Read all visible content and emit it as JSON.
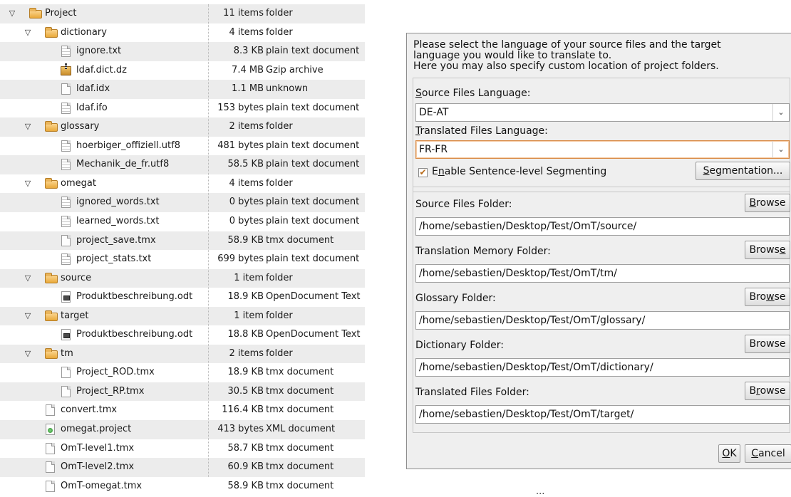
{
  "tree": {
    "rows": [
      {
        "name": "Project",
        "size": "11 items",
        "type": "folder",
        "kind": "folder",
        "depth": 0,
        "expander": true
      },
      {
        "name": "dictionary",
        "size": "4 items",
        "type": "folder",
        "kind": "folder",
        "depth": 1,
        "expander": true
      },
      {
        "name": "ignore.txt",
        "size": "8.3 KB",
        "type": "plain text document",
        "kind": "text",
        "depth": 2
      },
      {
        "name": "ldaf.dict.dz",
        "size": "7.4 MB",
        "type": "Gzip archive",
        "kind": "archive",
        "depth": 2
      },
      {
        "name": "ldaf.idx",
        "size": "1.1 MB",
        "type": "unknown",
        "kind": "file",
        "depth": 2
      },
      {
        "name": "ldaf.ifo",
        "size": "153 bytes",
        "type": "plain text document",
        "kind": "text",
        "depth": 2
      },
      {
        "name": "glossary",
        "size": "2 items",
        "type": "folder",
        "kind": "folder",
        "depth": 1,
        "expander": true
      },
      {
        "name": "hoerbiger_offiziell.utf8",
        "size": "481 bytes",
        "type": "plain text document",
        "kind": "text",
        "depth": 2
      },
      {
        "name": "Mechanik_de_fr.utf8",
        "size": "58.5 KB",
        "type": "plain text document",
        "kind": "text",
        "depth": 2
      },
      {
        "name": "omegat",
        "size": "4 items",
        "type": "folder",
        "kind": "folder",
        "depth": 1,
        "expander": true
      },
      {
        "name": "ignored_words.txt",
        "size": "0 bytes",
        "type": "plain text document",
        "kind": "text",
        "depth": 2
      },
      {
        "name": "learned_words.txt",
        "size": "0 bytes",
        "type": "plain text document",
        "kind": "text",
        "depth": 2
      },
      {
        "name": "project_save.tmx",
        "size": "58.9 KB",
        "type": "tmx document",
        "kind": "file",
        "depth": 2
      },
      {
        "name": "project_stats.txt",
        "size": "699 bytes",
        "type": "plain text document",
        "kind": "text",
        "depth": 2
      },
      {
        "name": "source",
        "size": "1 item",
        "type": "folder",
        "kind": "folder",
        "depth": 1,
        "expander": true
      },
      {
        "name": "Produktbeschreibung.odt",
        "size": "18.9 KB",
        "type": "OpenDocument Text",
        "kind": "odt",
        "depth": 2
      },
      {
        "name": "target",
        "size": "1 item",
        "type": "folder",
        "kind": "folder",
        "depth": 1,
        "expander": true
      },
      {
        "name": "Produktbeschreibung.odt",
        "size": "18.8 KB",
        "type": "OpenDocument Text",
        "kind": "odt",
        "depth": 2
      },
      {
        "name": "tm",
        "size": "2 items",
        "type": "folder",
        "kind": "folder",
        "depth": 1,
        "expander": true
      },
      {
        "name": "Project_ROD.tmx",
        "size": "18.9 KB",
        "type": "tmx document",
        "kind": "file",
        "depth": 2
      },
      {
        "name": "Project_RP.tmx",
        "size": "30.5 KB",
        "type": "tmx document",
        "kind": "file",
        "depth": 2
      },
      {
        "name": "convert.tmx",
        "size": "116.4 KB",
        "type": "tmx document",
        "kind": "file",
        "depth": 1
      },
      {
        "name": "omegat.project",
        "size": "413 bytes",
        "type": "XML document",
        "kind": "xml",
        "depth": 1
      },
      {
        "name": "OmT-level1.tmx",
        "size": "58.7 KB",
        "type": "tmx document",
        "kind": "file",
        "depth": 1
      },
      {
        "name": "OmT-level2.tmx",
        "size": "60.9 KB",
        "type": "tmx document",
        "kind": "file",
        "depth": 1
      },
      {
        "name": "OmT-omegat.tmx",
        "size": "58.9 KB",
        "type": "tmx document",
        "kind": "file",
        "depth": 1
      }
    ]
  },
  "dialog": {
    "intro": "Please select the language of your source files and the target\nlanguage you would like to translate to.\nHere you may also specify custom location of project folders.",
    "source_lang_label": {
      "pre": "",
      "key": "S",
      "post": "ource Files Language:"
    },
    "source_lang_value": "DE-AT",
    "target_lang_label": {
      "pre": "",
      "key": "T",
      "post": "ranslated Files Language:"
    },
    "target_lang_value": "FR-FR",
    "segmenting_checked": true,
    "segmenting_label": {
      "pre": "E",
      "key": "n",
      "post": "able Sentence-level Segmenting"
    },
    "segmentation_button": {
      "pre": "",
      "key": "S",
      "post": "egmentation..."
    },
    "folders": [
      {
        "label": "Source Files Folder:",
        "path": "/home/sebastien/Desktop/Test/OmT/source/",
        "browse": {
          "pre": "",
          "key": "B",
          "post": "rowse"
        }
      },
      {
        "label": "Translation Memory Folder:",
        "path": "/home/sebastien/Desktop/Test/OmT/tm/",
        "browse": {
          "pre": "Brows",
          "key": "e",
          "post": ""
        }
      },
      {
        "label": "Glossary Folder:",
        "path": "/home/sebastien/Desktop/Test/OmT/glossary/",
        "browse": {
          "pre": "Bro",
          "key": "w",
          "post": "se"
        }
      },
      {
        "label": "Dictionary Folder:",
        "path": "/home/sebastien/Desktop/Test/OmT/dictionary/",
        "browse": {
          "pre": "",
          "key": "",
          "post": "Browse"
        }
      },
      {
        "label": "Translated Files Folder:",
        "path": "/home/sebastien/Desktop/Test/OmT/target/",
        "browse": {
          "pre": "B",
          "key": "r",
          "post": "owse"
        }
      }
    ],
    "ok_button": {
      "pre": "",
      "key": "O",
      "post": "K"
    },
    "cancel_button": {
      "pre": "",
      "key": "C",
      "post": "ancel"
    }
  },
  "caption": "..."
}
